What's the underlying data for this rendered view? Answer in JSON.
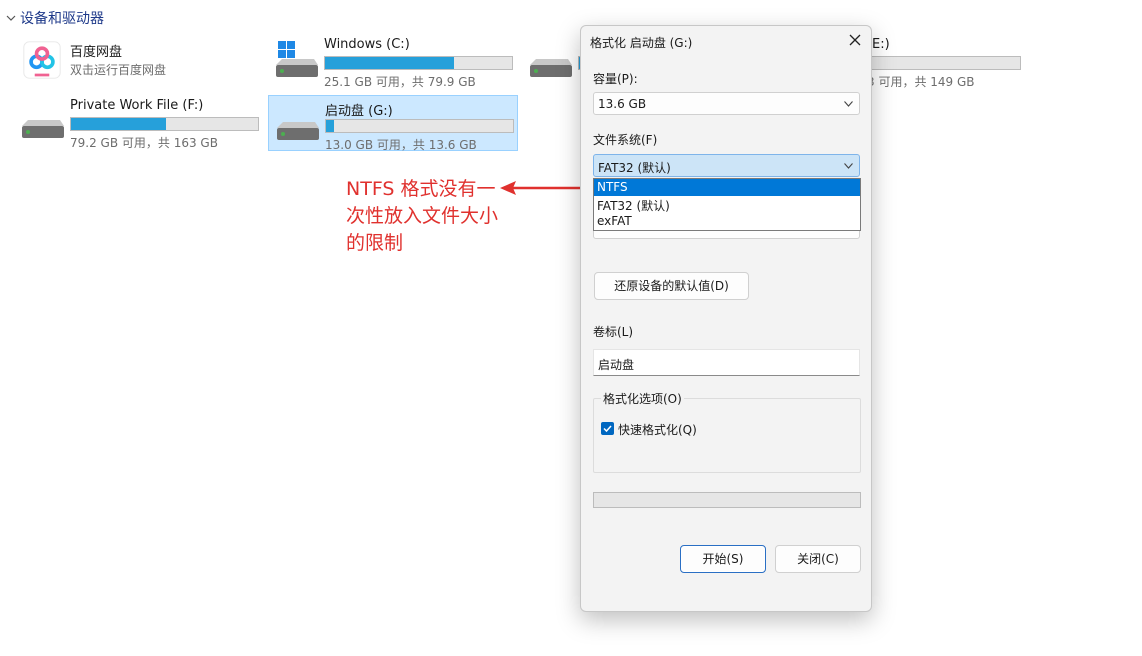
{
  "section": {
    "title": "设备和驱动器"
  },
  "drives": [
    {
      "name": "百度网盘",
      "subtitle": "双击运行百度网盘"
    },
    {
      "name": "Windows (C:)",
      "free_text": "25.1 GB 可用，共 79.9 GB",
      "used_fraction": 0.69
    },
    {
      "name_partial": "E:)",
      "free_partial": "3 可用，共 149 GB",
      "used_fraction": 0.6
    },
    {
      "name": "Private Work File (F:)",
      "free_text": "79.2 GB 可用，共 163 GB",
      "used_fraction": 0.51
    },
    {
      "name": "启动盘 (G:)",
      "free_text": "13.0 GB 可用，共 13.6 GB",
      "used_fraction": 0.045
    }
  ],
  "annotation": {
    "text": "NTFS 格式没有一次性放入文件大小的限制",
    "color": "#e0312e"
  },
  "dialog": {
    "title": "格式化 启动盘 (G:)",
    "capacity_label": "容量(P):",
    "capacity_value": "13.6 GB",
    "filesystem_label": "文件系统(F)",
    "filesystem_value": "FAT32 (默认)",
    "filesystem_options": [
      "NTFS",
      "FAT32 (默认)",
      "exFAT"
    ],
    "filesystem_selected_option": "NTFS",
    "restore_button": "还原设备的默认值(D)",
    "volume_label": "卷标(L)",
    "volume_value": "启动盘",
    "format_options_label": "格式化选项(O)",
    "quick_format_label": "快速格式化(Q)",
    "quick_format_checked": true,
    "start_button": "开始(S)",
    "close_button": "关闭(C)"
  }
}
